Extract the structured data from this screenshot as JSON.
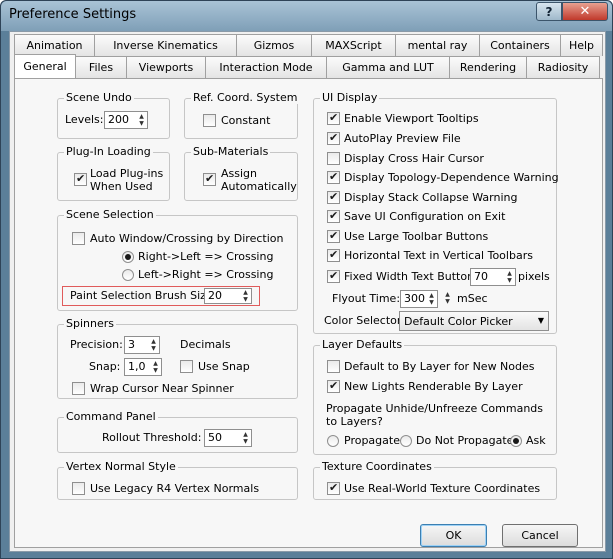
{
  "window": {
    "title": "Preference Settings",
    "help_glyph": "?",
    "close_glyph": "✕"
  },
  "tabs": {
    "row1": [
      "Animation",
      "Inverse Kinematics",
      "Gizmos",
      "MAXScript",
      "mental ray",
      "Containers",
      "Help"
    ],
    "row2": [
      "General",
      "Files",
      "Viewports",
      "Interaction Mode",
      "Gamma and LUT",
      "Rendering",
      "Radiosity"
    ],
    "active": "General"
  },
  "scene_undo": {
    "title": "Scene Undo",
    "levels_label": "Levels:",
    "levels_value": "200"
  },
  "ref_coord": {
    "title": "Ref. Coord. System",
    "constant_label": "Constant",
    "constant_checked": false
  },
  "plugin_loading": {
    "title": "Plug-In Loading",
    "load_label_1": "Load Plug-ins",
    "load_label_2": "When Used",
    "load_checked": true
  },
  "sub_materials": {
    "title": "Sub-Materials",
    "assign_label_1": "Assign",
    "assign_label_2": "Automatically",
    "assign_checked": true
  },
  "scene_selection": {
    "title": "Scene Selection",
    "auto_window_label": "Auto Window/Crossing by Direction",
    "auto_window_checked": false,
    "right_left_label": "Right->Left => Crossing",
    "left_right_label": "Left->Right => Crossing",
    "selected_direction": "right-left",
    "brush_size_label": "Paint Selection Brush Size",
    "brush_size_value": "20"
  },
  "spinners": {
    "title": "Spinners",
    "precision_label": "Precision:",
    "precision_value": "3",
    "decimals_label": "Decimals",
    "snap_label": "Snap:",
    "snap_value": "1,0",
    "use_snap_label": "Use Snap",
    "use_snap_checked": false,
    "wrap_cursor_label": "Wrap Cursor Near Spinner",
    "wrap_cursor_checked": false
  },
  "command_panel": {
    "title": "Command Panel",
    "rollout_label": "Rollout Threshold:",
    "rollout_value": "50"
  },
  "vertex_normal": {
    "title": "Vertex Normal Style",
    "legacy_label": "Use Legacy R4 Vertex Normals",
    "legacy_checked": false
  },
  "ui_display": {
    "title": "UI Display",
    "items": [
      {
        "label": "Enable Viewport Tooltips",
        "checked": true
      },
      {
        "label": "AutoPlay Preview File",
        "checked": true
      },
      {
        "label": "Display Cross Hair Cursor",
        "checked": false
      },
      {
        "label": "Display Topology-Dependence Warning",
        "checked": true
      },
      {
        "label": "Display Stack Collapse Warning",
        "checked": true
      },
      {
        "label": "Save UI Configuration on Exit",
        "checked": true
      },
      {
        "label": "Use Large Toolbar Buttons",
        "checked": true
      },
      {
        "label": "Horizontal Text in Vertical Toolbars",
        "checked": true
      },
      {
        "label": "Fixed Width Text Buttons:",
        "checked": true
      }
    ],
    "fixed_width_value": "70",
    "pixels_label": "pixels",
    "flyout_label": "Flyout Time:",
    "flyout_value": "300",
    "msec_label": "mSec",
    "color_selector_label": "Color Selector:",
    "color_selector_value": "Default Color Picker"
  },
  "layer_defaults": {
    "title": "Layer Defaults",
    "default_by_layer_label": "Default to By Layer for New Nodes",
    "default_by_layer_checked": false,
    "new_lights_label": "New Lights Renderable By Layer",
    "new_lights_checked": true,
    "propagate_line_1": "Propagate Unhide/Unfreeze Commands",
    "propagate_line_2": "to Layers?",
    "propagate_label": "Propagate",
    "do_not_propagate_label": "Do Not Propagate",
    "ask_label": "Ask",
    "selected_option": "ask"
  },
  "texture_coords": {
    "title": "Texture Coordinates",
    "real_world_label": "Use Real-World Texture Coordinates",
    "real_world_checked": true
  },
  "buttons": {
    "ok": "OK",
    "cancel": "Cancel"
  }
}
